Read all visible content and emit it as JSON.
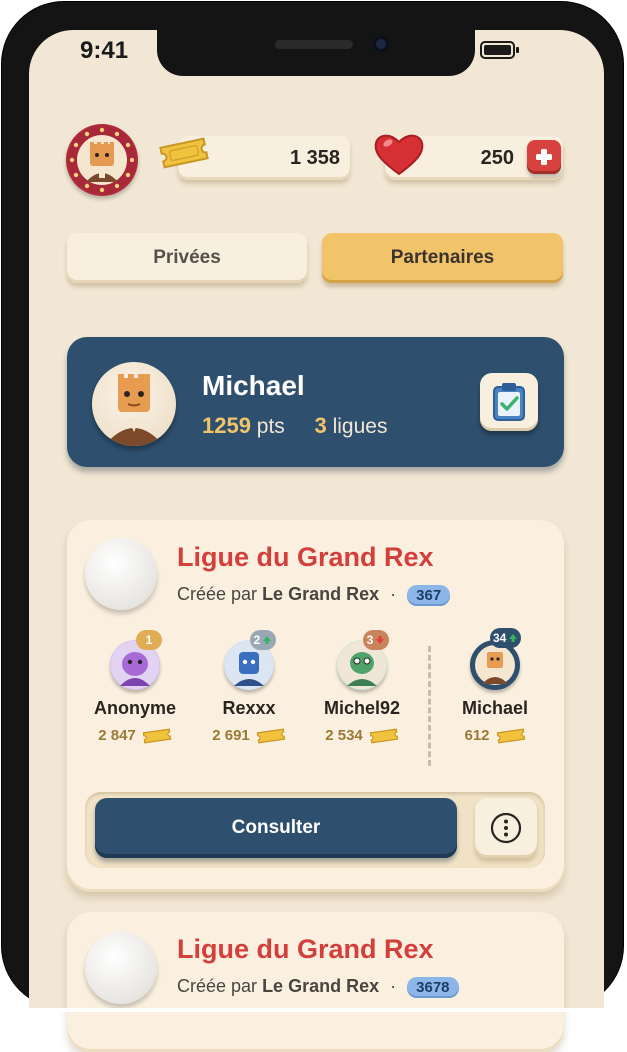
{
  "status_bar": {
    "time": "9:41"
  },
  "top_bar": {
    "tickets": "1 358",
    "lives": "250"
  },
  "tabs": [
    {
      "label": "Privées",
      "active": false
    },
    {
      "label": "Partenaires",
      "active": true
    }
  ],
  "profile": {
    "name": "Michael",
    "points": "1259",
    "points_unit": "pts",
    "leagues": "3",
    "leagues_unit": "ligues"
  },
  "leagues": [
    {
      "title": "Ligue du Grand Rex",
      "created_by_prefix": "Créée par",
      "creator": "Le Grand Rex",
      "separator": "·",
      "members": "367",
      "players": [
        {
          "rank": "1",
          "name": "Anonyme",
          "score": "2 847",
          "trend": "none"
        },
        {
          "rank": "2",
          "name": "Rexxx",
          "score": "2 691",
          "trend": "up"
        },
        {
          "rank": "3",
          "name": "Michel92",
          "score": "2 534",
          "trend": "down"
        },
        {
          "rank": "34",
          "name": "Michael",
          "score": "612",
          "trend": "up"
        }
      ],
      "consult_label": "Consulter"
    },
    {
      "title": "Ligue du Grand Rex",
      "created_by_prefix": "Créée par",
      "creator": "Le Grand Rex",
      "separator": "·",
      "members": "3678"
    }
  ],
  "colors": {
    "background": "#f2e7d4",
    "navy": "#2e4f6e",
    "accent_red": "#d33f3a",
    "gold": "#f2c46a",
    "member_badge": "#8cb6e8"
  }
}
